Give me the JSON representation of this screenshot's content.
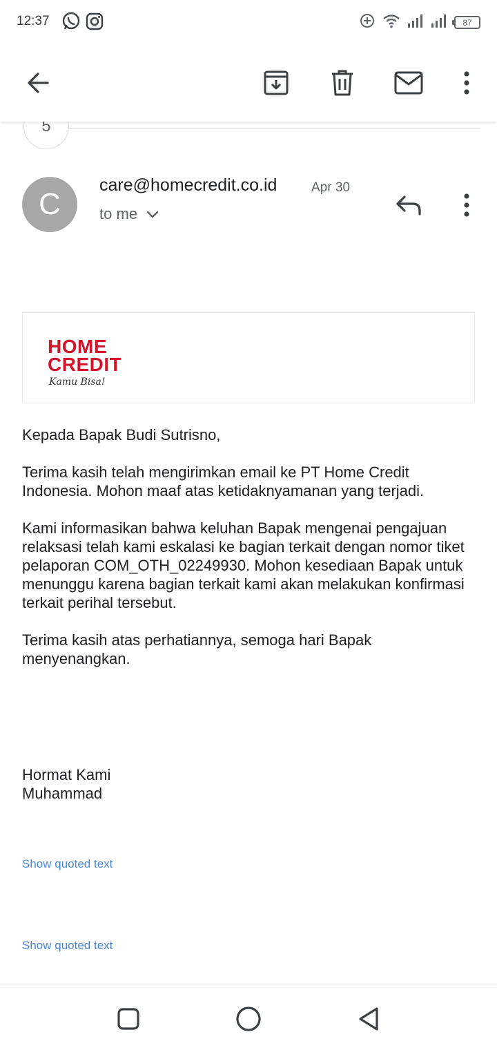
{
  "status_bar": {
    "time": "12:37",
    "left_icons": [
      "whatsapp-icon",
      "instagram-icon"
    ],
    "right_icons": [
      "data-saver-icon",
      "wifi-icon",
      "signal-icon",
      "signal-icon"
    ],
    "battery": "87"
  },
  "app_bar": {
    "icons": [
      "back-arrow-icon",
      "archive-icon",
      "delete-icon",
      "mark-unread-icon",
      "more-vert-icon"
    ]
  },
  "thread": {
    "collapsed_count": "5"
  },
  "message": {
    "avatar_letter": "C",
    "sender": "care@homecredit.co.id",
    "date": "Apr 30",
    "recipient": "to me",
    "logo": {
      "line1": "HOME",
      "line2": "CREDIT",
      "tagline": "Kamu Bisa!"
    },
    "paragraphs": [
      "Kepada Bapak Budi Sutrisno,",
      "Terima kasih telah mengirimkan email ke PT Home Credit Indonesia. Mohon maaf atas ketidaknyamanan yang terjadi.",
      "Kami informasikan bahwa keluhan Bapak mengenai pengajuan relaksasi telah kami eskalasi ke bagian terkait dengan nomor tiket pelaporan COM_OTH_02249930. Mohon kesediaan Bapak untuk menunggu karena bagian terkait kami akan melakukan konfirmasi terkait perihal tersebut.",
      "Terima kasih atas perhatiannya, semoga hari Bapak menyenangkan."
    ],
    "signature": [
      "Hormat Kami",
      "Muhammad"
    ],
    "show_quoted_1": "Show quoted text",
    "show_quoted_2": "Show quoted text"
  },
  "nav_bar": {
    "icons": [
      "recents-icon",
      "home-icon",
      "back-icon"
    ]
  },
  "colors": {
    "brand_red": "#d3152c",
    "link_blue": "#4a86d8",
    "avatar_grey": "#a7a7a7"
  }
}
